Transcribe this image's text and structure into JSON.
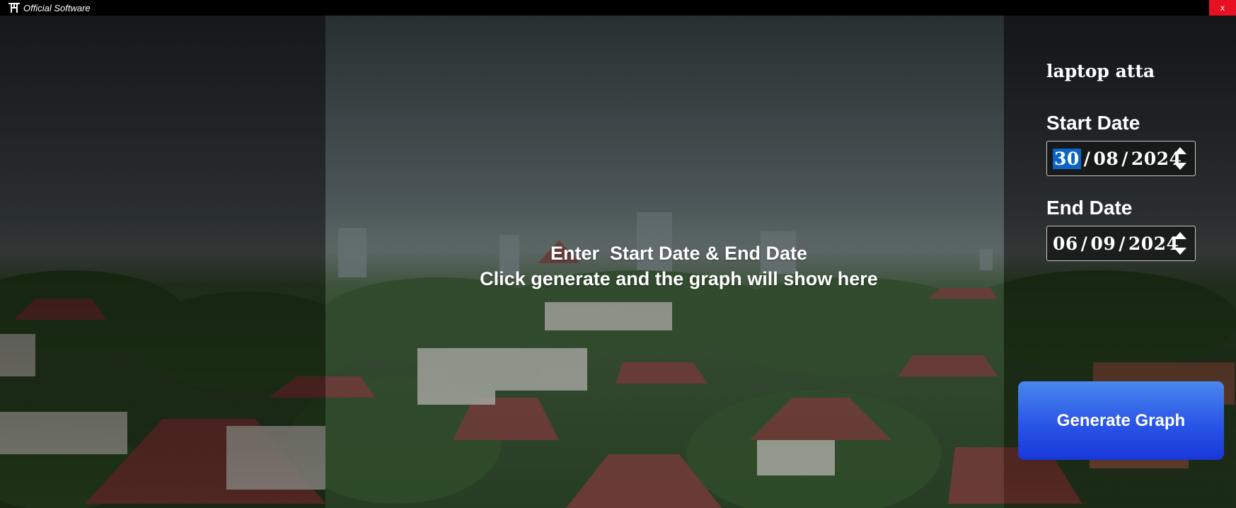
{
  "window": {
    "title": "Official Software",
    "close_label": "x",
    "logo_icon": "app-logo-icon"
  },
  "message": {
    "line1": "Enter  Start Date & End Date",
    "line2": "Click generate and the graph will show here"
  },
  "user": {
    "name": "laptop atta"
  },
  "start_date": {
    "label": "Start Date",
    "day": "30",
    "month": "08",
    "year": "2024",
    "separator": "/",
    "selected_segment": "day"
  },
  "end_date": {
    "label": "End Date",
    "day": "06",
    "month": "09",
    "year": "2024",
    "separator": "/"
  },
  "generate": {
    "label": "Generate Graph"
  },
  "colors": {
    "titlebar": "#000000",
    "close": "#e81123",
    "button_top": "#4a88ee",
    "button_bottom": "#1838d8",
    "selection": "#0a64c8"
  }
}
